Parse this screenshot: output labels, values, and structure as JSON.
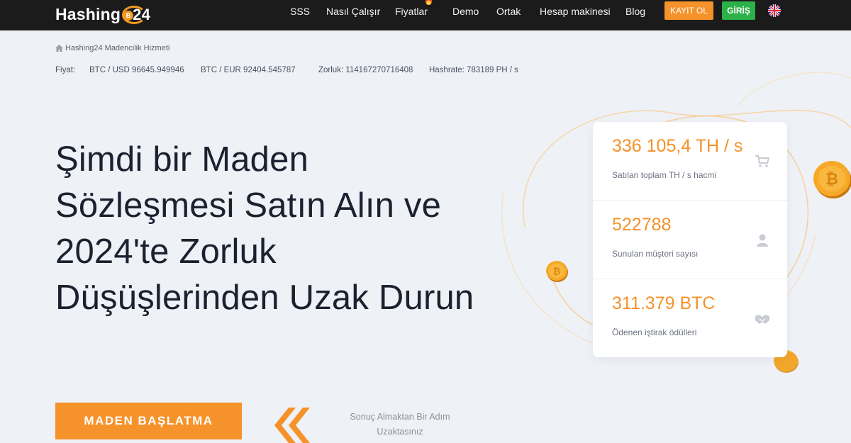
{
  "brand": {
    "name": "Hashing",
    "badge_letter": "B",
    "badge_number": "24"
  },
  "nav": {
    "items": [
      "SSS",
      "Nasıl Çalışır",
      "Fiyatlar",
      "Demo",
      "Ortak",
      "Hesap makinesi",
      "Blog"
    ],
    "register_label": "KAYIT OL",
    "login_label": "GİRİŞ",
    "language_icon": "uk-flag-icon"
  },
  "breadcrumb": {
    "label": "Hashing24 Madencilik Hizmeti"
  },
  "ticker": {
    "price_label": "Fiyat:",
    "btc_usd": "BTC / USD 96645.949946",
    "btc_eur": "BTC / EUR 92404.545787",
    "difficulty": "Zorluk: 114167270716408",
    "hashrate": "Hashrate: 783189 PH / s"
  },
  "hero": {
    "title": "Şimdi bir Maden Sözleşmesi Satın Alın ve 2024'te Zorluk Düşüşlerinden Uzak Durun",
    "cta_label": "MADEN BAŞLATMA",
    "cta_note": "Sonuç Almaktan Bir Adım Uzaktasınız"
  },
  "stats": [
    {
      "value": "336 105,4 TH / s",
      "label": "Satılan toplam TH / s hacmi",
      "icon": "cart-icon"
    },
    {
      "value": "522788",
      "label": "Sunulan müşteri sayısı",
      "icon": "user-icon"
    },
    {
      "value": "311.379 BTC",
      "label": "Ödenen iştirak ödülleri",
      "icon": "handshake-icon"
    }
  ],
  "colors": {
    "accent": "#f5922a",
    "login": "#2cb14a",
    "header_bg": "#1b1b1b",
    "page_bg": "#eef1f6"
  }
}
